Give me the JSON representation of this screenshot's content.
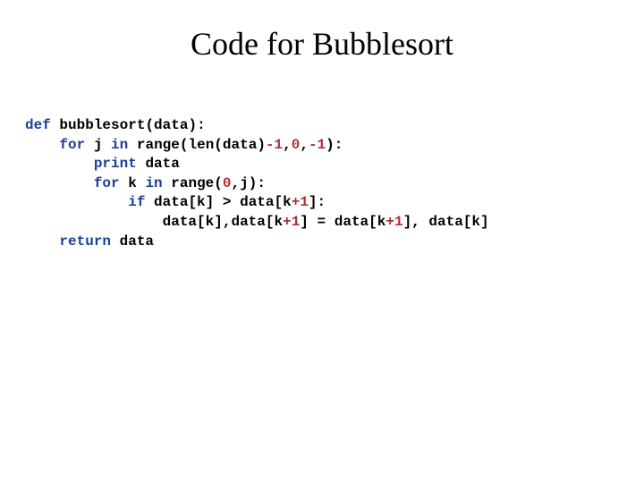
{
  "title": "Code for Bubblesort",
  "code": {
    "tokens": {
      "def": "def",
      "for": "for",
      "in": "in",
      "if": "if",
      "return": "return",
      "print": "print",
      "bubblesort": "bubblesort",
      "data": "data",
      "j": "j",
      "k": "k",
      "range": "range",
      "len": "len",
      "minus1": "-1",
      "zero": "0",
      "one": "1",
      "plus1": "+1",
      "lparen": "(",
      "rparen": ")",
      "lbrack": "[",
      "rbrack": "]",
      "colon": ":",
      "comma": ",",
      "gt": ">",
      "eq": "=",
      "sp": " ",
      "sp2": "  "
    }
  }
}
